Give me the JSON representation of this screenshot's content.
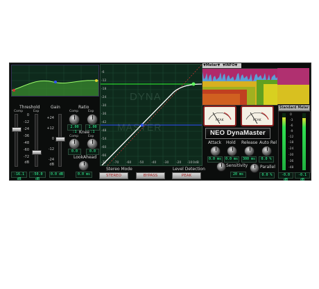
{
  "left": {
    "threshold_label": "Threshold",
    "gain_label": "Gain",
    "ratio_label": "Ratio",
    "comp_label": "Comp",
    "exp_label": "Exp",
    "knee_label": "Knee",
    "lookahead_label": "LookAhead",
    "scale_left": [
      "0",
      "-12",
      "-24",
      "-36",
      "-48",
      "-60",
      "-72",
      "dB"
    ],
    "scale_gain": [
      "+24",
      "+12",
      "0",
      "-12",
      "-24",
      "dB"
    ],
    "ratio_comp_value": "2.00 :1",
    "ratio_exp_value": "1.00 :1",
    "knee_comp_value": "0.0",
    "knee_exp_value": "0.0",
    "lookahead_value": "0.0 ms",
    "threshold_comp_value": "-16.1 dB",
    "threshold_exp_value": "-50.0 dB",
    "gain_value": "0.0 dB"
  },
  "graph": {
    "watermark_top": "DYNA",
    "watermark_bottom": "MASTER",
    "y_ticks": [
      "-6",
      "-12",
      "-18",
      "-24",
      "-30",
      "-36",
      "-42",
      "-48",
      "-54",
      "-60",
      "-66",
      "-72"
    ],
    "x_ticks": [
      "-70",
      "-60",
      "-50",
      "-40",
      "-30",
      "-20",
      "-10",
      "0dB"
    ],
    "stereo_mode_label": "Stereo Mode",
    "stereo_mode_value": "STEREO",
    "bypass_label": "BYPASS",
    "level_detection_label": "Level Detection",
    "level_detection_value": "PEAK"
  },
  "right": {
    "meter_tab": "▼Meter▼",
    "info_tab": "▼INFO▼",
    "vu_left_label": "PEAK",
    "vu_right_label": "PEAK",
    "logo": "NEO DynaMaster",
    "attack_label": "Attack",
    "hold_label": "Hold",
    "release_label": "Release",
    "autorel_label": "Auto Rel",
    "attack_value": "0.0 ms",
    "hold_value": "0.0 ms",
    "release_value": "300 ms",
    "autorel_value": "0.0 %",
    "sensitivity_label": "Sensitivity",
    "sensitivity_value": "20 ms",
    "parallel_label": "Parallel",
    "parallel_value": "0.0 %",
    "standard_meter_button": "Standard Meter",
    "meter_scale": [
      "0",
      "-3",
      "-6",
      "-9",
      "-12",
      "-18",
      "-24",
      "-30",
      "-36",
      "-48"
    ],
    "meter_left_value": "-0.0 dB",
    "meter_right_value": "-0.1 dB"
  },
  "colors": {
    "panel_bg": "#0b0d0c",
    "green_accent": "#32ff9a",
    "graph_bg": "#0e2a1c",
    "vu_frame": "#8a2020",
    "transfer_curve": "#ffffff",
    "threshold_line": "#30ff30",
    "blue_marker": "#3050ff"
  }
}
